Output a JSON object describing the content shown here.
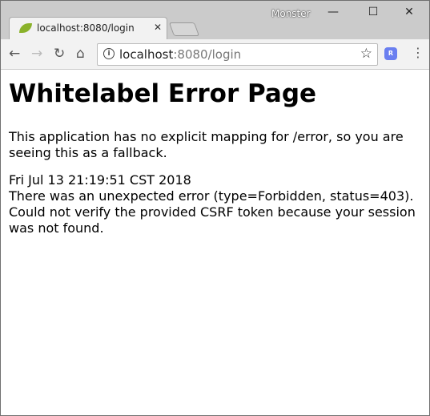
{
  "window": {
    "user": "Monster",
    "minimize": "—",
    "maximize": "☐",
    "close": "✕"
  },
  "tab": {
    "title": "localhost:8080/login",
    "close": "✕"
  },
  "toolbar": {
    "back": "←",
    "forward": "→",
    "reload": "↻",
    "home": "⌂",
    "url_host": "localhost",
    "url_rest": ":8080/login",
    "info": "i",
    "star": "☆",
    "ext": "R",
    "menu": "⋮"
  },
  "page": {
    "title": "Whitelabel Error Page",
    "description": "This application has no explicit mapping for /error, so you are seeing this as a fallback.",
    "timestamp": "Fri Jul 13 21:19:51 CST 2018",
    "error": "There was an unexpected error (type=Forbidden, status=403).",
    "message": "Could not verify the provided CSRF token because your session was not found."
  }
}
